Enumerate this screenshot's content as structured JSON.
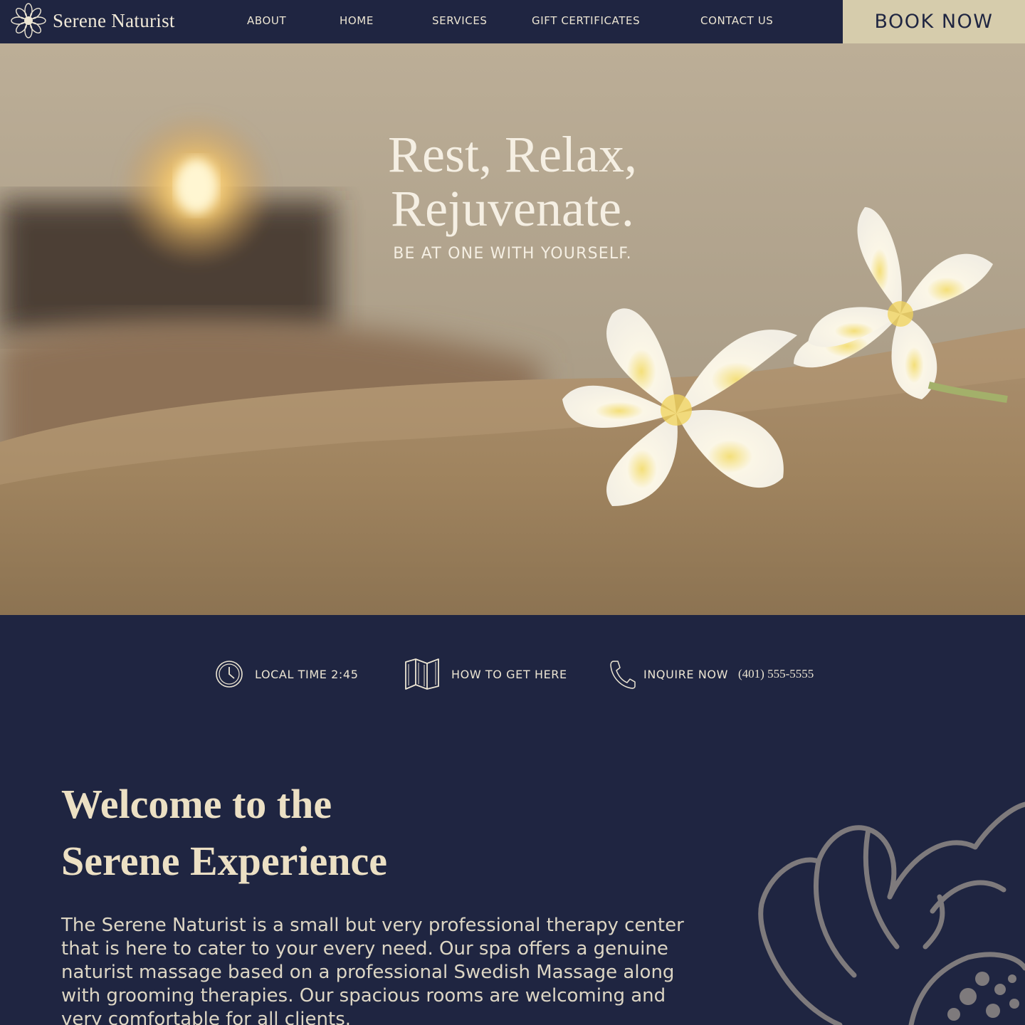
{
  "brand": {
    "name": "Serene Naturist",
    "logo_icon": "flower-icon"
  },
  "nav": {
    "items": [
      {
        "label": "ABOUT"
      },
      {
        "label": "HOME"
      },
      {
        "label": "SERVICES"
      },
      {
        "label": "GIFT CERTIFICATES"
      },
      {
        "label": "CONTACT US"
      }
    ],
    "book_label": "BOOK NOW"
  },
  "hero": {
    "title_line1": "Rest, Relax,",
    "title_line2": "Rejuvenate.",
    "subtitle": "BE AT ONE WITH YOURSELF."
  },
  "info": {
    "time_label": "LOCAL TIME 2:45",
    "time_icon": "clock-icon",
    "directions_label": "HOW TO GET HERE",
    "directions_icon": "map-icon",
    "inquire_label": "INQUIRE NOW",
    "inquire_icon": "phone-icon",
    "phone": "(401) 555-5555"
  },
  "welcome": {
    "heading_line1": "Welcome to the",
    "heading_line2": "Serene Experience",
    "body": "The Serene Naturist is a small but very professional therapy center that is here to cater to your every need. Our spa offers a genuine naturist massage based on a professional Swedish Massage along with grooming therapies. Our spacious rooms are welcoming and very comfortable for all clients."
  },
  "colors": {
    "navy": "#1f2541",
    "cream": "#d6ccac",
    "text_light": "#ece5d3"
  }
}
